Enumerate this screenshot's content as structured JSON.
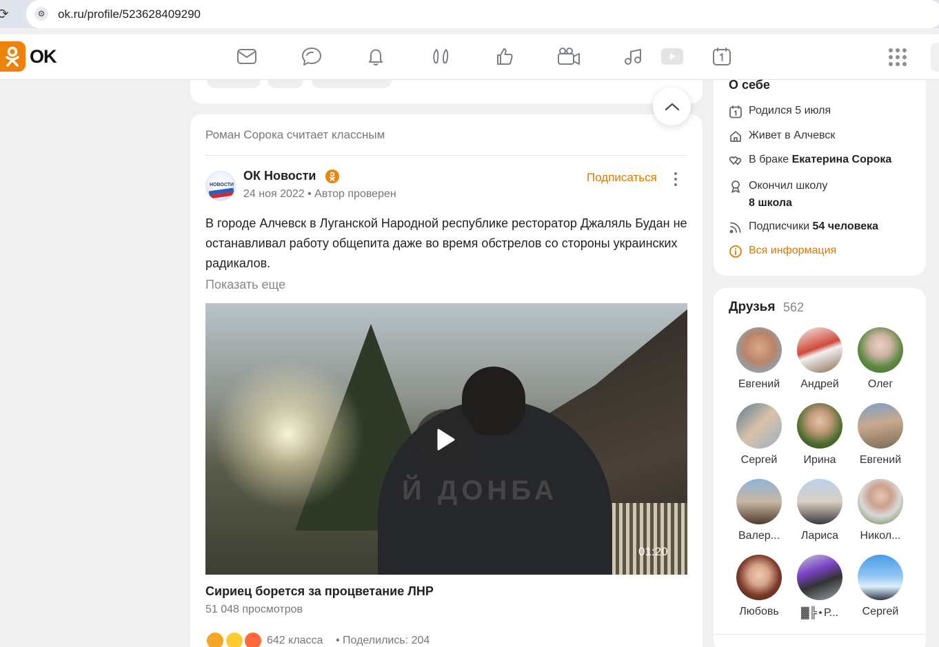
{
  "browser": {
    "url": "ok.ru/profile/523628409290"
  },
  "topnav": {
    "logo_text": "OK",
    "icons": [
      "mail-icon",
      "messages-icon",
      "notifications-icon",
      "guests-icon",
      "likes-icon",
      "video-camera-icon",
      "music-icon",
      "video-play-icon",
      "calendar-icon",
      "apps-grid-icon"
    ]
  },
  "post": {
    "liked_by": "Роман Сорока считает классным",
    "author": "ОК Новости",
    "date": "24 ноя 2022 • Автор проверен",
    "subscribe_label": "Подписаться",
    "text": "В городе Алчевск в Луганской Народной республике ресторатор Джаляль Будан не останавливал работу общепита даже во время обстрелов со стороны украинских радикалов.",
    "show_more": "Показать еще",
    "video": {
      "duration": "01:20",
      "title": "Сириец борется за процветание ЛНР",
      "views": "51 048 просмотров"
    },
    "reactions_count": "642 класса",
    "shares": "•   Поделились: 204"
  },
  "about": {
    "title": "О себе",
    "born": "Родился 5 июля",
    "lives": "Живет в Алчевск",
    "married_prefix": "В браке",
    "married_name": "Екатерина Сорока",
    "school_prefix": "Окончил школу",
    "school_name": "8 школа",
    "followers_prefix": "Подписчики",
    "followers_count": "54 человека",
    "all_info": "Вся информация"
  },
  "friends": {
    "title": "Друзья",
    "count": "562",
    "list": [
      {
        "name": "Евгений"
      },
      {
        "name": "Андрей"
      },
      {
        "name": "Олег"
      },
      {
        "name": "Сергей"
      },
      {
        "name": "Ирина"
      },
      {
        "name": "Евгений"
      },
      {
        "name": "Валер..."
      },
      {
        "name": "Лариса"
      },
      {
        "name": "Никол..."
      },
      {
        "name": "Любовь"
      },
      {
        "name": "▓╠⋆Р..."
      },
      {
        "name": "Сергей"
      }
    ]
  },
  "colors": {
    "brand": "#ee8208",
    "accent_text": "#e07800"
  }
}
